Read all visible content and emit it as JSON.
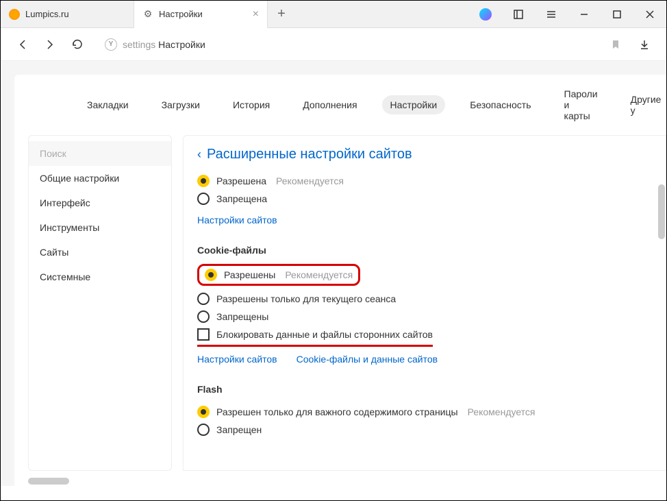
{
  "tabs": [
    {
      "label": "Lumpics.ru",
      "active": false
    },
    {
      "label": "Настройки",
      "active": true
    }
  ],
  "url": {
    "prefix": "settings",
    "page": "Настройки"
  },
  "top_nav": [
    "Закладки",
    "Загрузки",
    "История",
    "Дополнения",
    "Настройки",
    "Безопасность",
    "Пароли и карты",
    "Другие у"
  ],
  "top_nav_active_index": 4,
  "sidebar": {
    "search_placeholder": "Поиск",
    "items": [
      "Общие настройки",
      "Интерфейс",
      "Инструменты",
      "Сайты",
      "Системные"
    ]
  },
  "page_title": "Расширенные настройки сайтов",
  "section1": {
    "opt1": {
      "label": "Разрешена",
      "hint": "Рекомендуется",
      "selected": true
    },
    "opt2": {
      "label": "Запрещена",
      "selected": false
    },
    "link": "Настройки сайтов"
  },
  "cookies": {
    "title": "Cookie-файлы",
    "opt1": {
      "label": "Разрешены",
      "hint": "Рекомендуется",
      "selected": true
    },
    "opt2": {
      "label": "Разрешены только для текущего сеанса",
      "selected": false
    },
    "opt3": {
      "label": "Запрещены",
      "selected": false
    },
    "checkbox_label": "Блокировать данные и файлы сторонних сайтов",
    "link1": "Настройки сайтов",
    "link2": "Cookie-файлы и данные сайтов"
  },
  "flash": {
    "title": "Flash",
    "opt1": {
      "label": "Разрешен только для важного содержимого страницы",
      "hint": "Рекомендуется",
      "selected": true
    },
    "opt2": {
      "label": "Запрещен",
      "selected": false
    }
  }
}
